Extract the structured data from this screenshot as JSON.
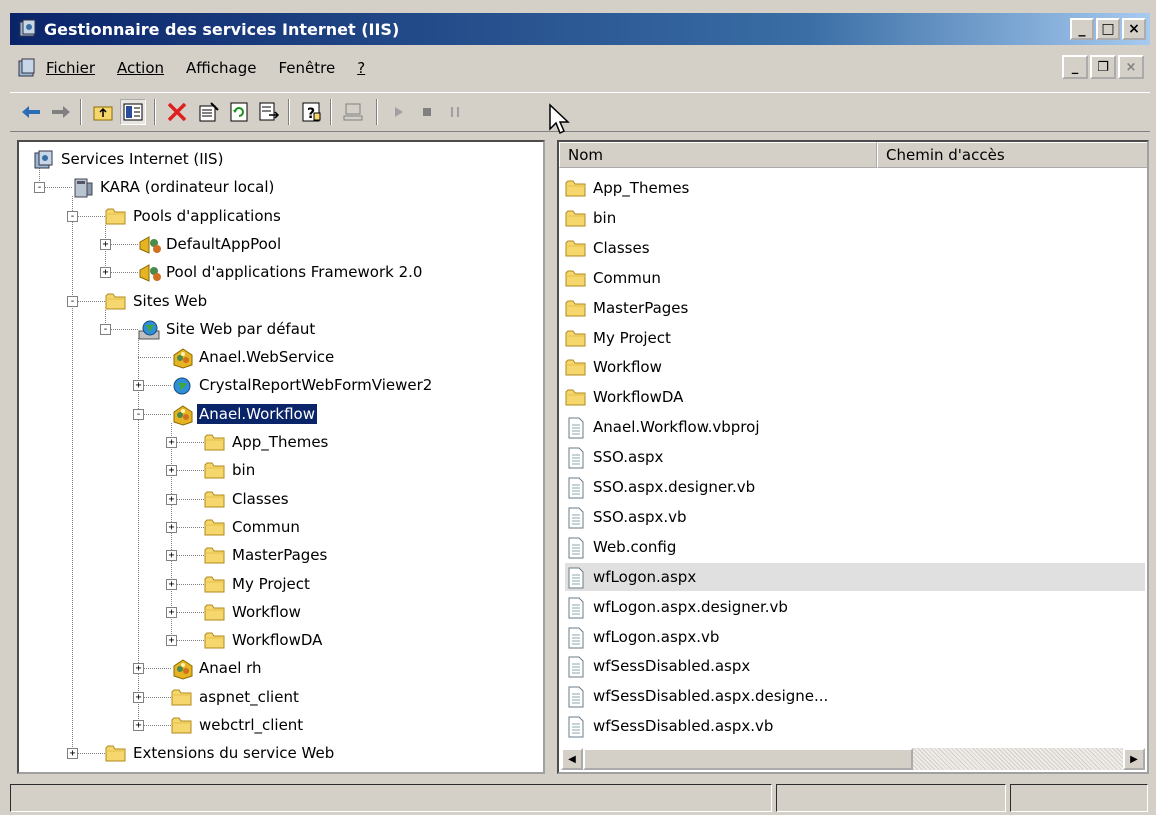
{
  "window": {
    "title": "Gestionnaire des services Internet (IIS)"
  },
  "menubar": {
    "items": [
      {
        "label": "Fichier",
        "access_key": "F"
      },
      {
        "label": "Action",
        "access_key": "A"
      },
      {
        "label": "Affichage",
        "access_key": "h"
      },
      {
        "label": "Fenêtre",
        "access_key": "t"
      },
      {
        "label": "?",
        "access_key": "?"
      }
    ]
  },
  "toolbar": {
    "buttons": [
      "back-arrow-icon",
      "forward-arrow-icon",
      "up-folder-icon",
      "show-hide-tree-icon",
      "delete-icon",
      "properties-icon",
      "refresh-icon",
      "export-list-icon",
      "help-icon",
      "connect-computer-icon",
      "start-icon",
      "stop-icon",
      "pause-icon"
    ]
  },
  "tree": {
    "nodes": [
      {
        "label": "Services Internet (IIS)",
        "level": 0,
        "icon": "iis-root-icon",
        "expander": ""
      },
      {
        "label": "KARA (ordinateur local)",
        "level": 1,
        "icon": "computer-icon",
        "expander": "-"
      },
      {
        "label": "Pools d'applications",
        "level": 2,
        "icon": "folder-icon",
        "expander": "-"
      },
      {
        "label": "DefaultAppPool",
        "level": 3,
        "icon": "app-pool-icon",
        "expander": "+"
      },
      {
        "label": "Pool d'applications Framework 2.0",
        "level": 3,
        "icon": "app-pool-icon",
        "expander": "+"
      },
      {
        "label": "Sites Web",
        "level": 2,
        "icon": "folder-icon",
        "expander": "-"
      },
      {
        "label": "Site Web par défaut",
        "level": 3,
        "icon": "website-globe-icon",
        "expander": "-"
      },
      {
        "label": "Anael.WebService",
        "level": 4,
        "icon": "web-application-icon",
        "expander": ""
      },
      {
        "label": "CrystalReportWebFormViewer2",
        "level": 4,
        "icon": "globe-icon",
        "expander": "+"
      },
      {
        "label": "Anael.Workflow",
        "level": 4,
        "icon": "web-application-icon",
        "expander": "-",
        "selected": true
      },
      {
        "label": "App_Themes",
        "level": 5,
        "icon": "folder-icon",
        "expander": "+"
      },
      {
        "label": "bin",
        "level": 5,
        "icon": "folder-icon",
        "expander": "+"
      },
      {
        "label": "Classes",
        "level": 5,
        "icon": "folder-icon",
        "expander": "+"
      },
      {
        "label": "Commun",
        "level": 5,
        "icon": "folder-icon",
        "expander": "+"
      },
      {
        "label": "MasterPages",
        "level": 5,
        "icon": "folder-icon",
        "expander": "+"
      },
      {
        "label": "My Project",
        "level": 5,
        "icon": "folder-icon",
        "expander": "+"
      },
      {
        "label": "Workflow",
        "level": 5,
        "icon": "folder-icon",
        "expander": "+"
      },
      {
        "label": "WorkflowDA",
        "level": 5,
        "icon": "folder-icon",
        "expander": "+"
      },
      {
        "label": "Anael rh",
        "level": 4,
        "icon": "web-application-icon",
        "expander": "+"
      },
      {
        "label": "aspnet_client",
        "level": 4,
        "icon": "folder-icon",
        "expander": "+"
      },
      {
        "label": "webctrl_client",
        "level": 4,
        "icon": "folder-icon",
        "expander": "+"
      },
      {
        "label": "Extensions du service Web",
        "level": 2,
        "icon": "folder-icon",
        "expander": "+"
      }
    ]
  },
  "listview": {
    "columns": [
      "Nom",
      "Chemin d'accès"
    ],
    "rows": [
      {
        "name": "App_Themes",
        "icon": "folder-icon"
      },
      {
        "name": "bin",
        "icon": "folder-icon"
      },
      {
        "name": "Classes",
        "icon": "folder-icon"
      },
      {
        "name": "Commun",
        "icon": "folder-icon"
      },
      {
        "name": "MasterPages",
        "icon": "folder-icon"
      },
      {
        "name": "My Project",
        "icon": "folder-icon"
      },
      {
        "name": "Workflow",
        "icon": "folder-icon"
      },
      {
        "name": "WorkflowDA",
        "icon": "folder-icon"
      },
      {
        "name": "Anael.Workflow.vbproj",
        "icon": "file-icon"
      },
      {
        "name": "SSO.aspx",
        "icon": "file-icon"
      },
      {
        "name": "SSO.aspx.designer.vb",
        "icon": "file-icon"
      },
      {
        "name": "SSO.aspx.vb",
        "icon": "file-icon"
      },
      {
        "name": "Web.config",
        "icon": "file-icon"
      },
      {
        "name": "wfLogon.aspx",
        "icon": "file-icon",
        "highlight": true
      },
      {
        "name": "wfLogon.aspx.designer.vb",
        "icon": "file-icon"
      },
      {
        "name": "wfLogon.aspx.vb",
        "icon": "file-icon"
      },
      {
        "name": "wfSessDisabled.aspx",
        "icon": "file-icon"
      },
      {
        "name": "wfSessDisabled.aspx.designe...",
        "icon": "file-icon"
      },
      {
        "name": "wfSessDisabled.aspx.vb",
        "icon": "file-icon"
      }
    ]
  },
  "colors": {
    "title_gradient_start": "#0a246a",
    "title_gradient_end": "#a6caf0",
    "selection": "#0a246a",
    "chrome": "#d4d0c8",
    "folder": "#f5d76e"
  }
}
